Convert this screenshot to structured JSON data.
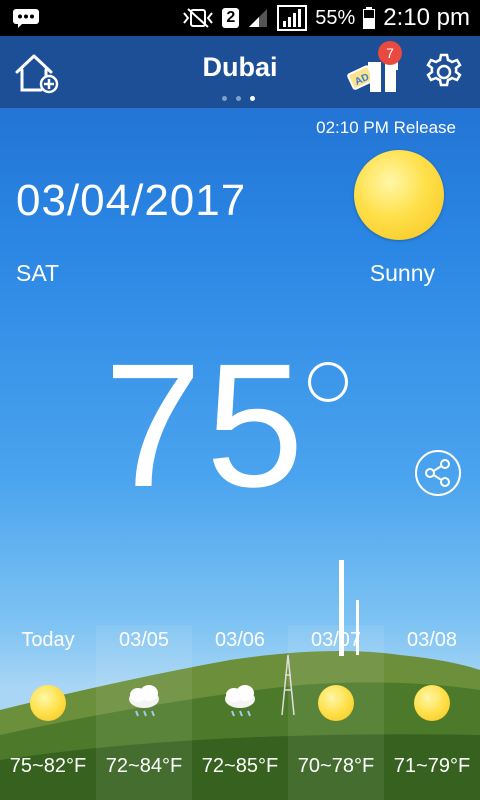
{
  "status_bar": {
    "sim_slot": "2",
    "battery_percent": "55%",
    "time": "2:10 pm"
  },
  "header": {
    "city": "Dubai",
    "badge_count": "7",
    "page_indicator": {
      "count": 3,
      "active": 3
    }
  },
  "current": {
    "release": "02:10 PM Release",
    "date": "03/04/2017",
    "day": "SAT",
    "condition": "Sunny",
    "temperature": "75"
  },
  "forecast": [
    {
      "label": "Today",
      "range": "75~82°F",
      "icon": "sun-icon"
    },
    {
      "label": "03/05",
      "range": "72~84°F",
      "icon": "rain-cloud-icon"
    },
    {
      "label": "03/06",
      "range": "72~85°F",
      "icon": "rain-cloud-icon"
    },
    {
      "label": "03/07",
      "range": "70~78°F",
      "icon": "sun-icon"
    },
    {
      "label": "03/08",
      "range": "71~79°F",
      "icon": "sun-icon"
    }
  ],
  "colors": {
    "header": "#1c4f96",
    "sky_top": "#1e66c8",
    "sun": "#ffe04a",
    "badge": "#e84a3f"
  }
}
